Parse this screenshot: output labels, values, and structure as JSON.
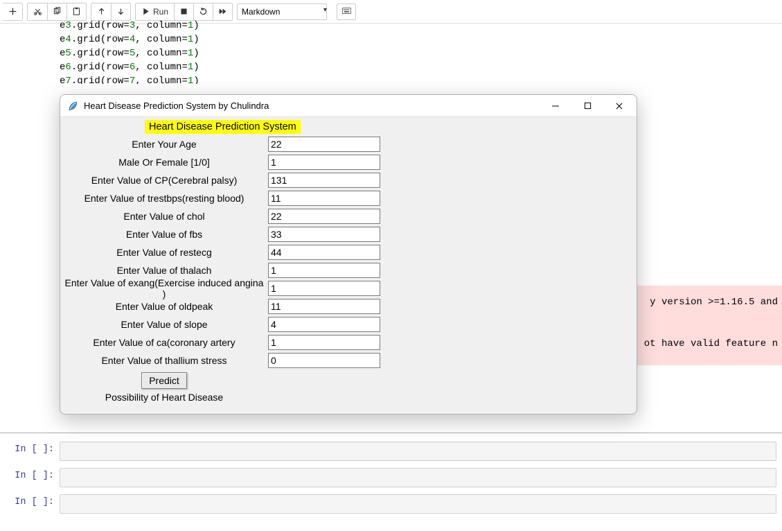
{
  "toolbar": {
    "save_icon": "save",
    "cut_icon": "cut",
    "copy_icon": "copy",
    "paste_icon": "paste",
    "up_icon": "up",
    "down_icon": "down",
    "run_label": "Run",
    "stop_icon": "stop",
    "restart_icon": "restart",
    "ff_icon": "fast-forward",
    "cell_type": "Markdown",
    "cmd_palette_icon": "keyboard"
  },
  "code_fragment_lines": [
    "e3.grid(row=3, column=1)",
    "e4.grid(row=4, column=1)",
    "e5.grid(row=5, column=1)",
    "e6.grid(row=6, column=1)",
    "e7.grid(row=7, column=1)"
  ],
  "warning": {
    "line1": "y version >=1.16.5 and",
    "line2": "ot have valid feature n"
  },
  "empty_cells": [
    "In [ ]:",
    "In [ ]:",
    "In [ ]:"
  ],
  "tk": {
    "window_title": "Heart Disease Prediction System by Chulindra",
    "heading": "Heart Disease Prediction System",
    "fields": [
      {
        "label": "Enter Your Age",
        "value": "22"
      },
      {
        "label": "Male Or Female [1/0]",
        "value": "1"
      },
      {
        "label": "Enter Value of CP(Cerebral palsy)",
        "value": "131"
      },
      {
        "label": "Enter Value of trestbps(resting blood)",
        "value": "11"
      },
      {
        "label": "Enter Value of chol",
        "value": "22"
      },
      {
        "label": "Enter Value of fbs",
        "value": "33"
      },
      {
        "label": "Enter Value of restecg",
        "value": "44"
      },
      {
        "label": "Enter Value of thalach",
        "value": "1"
      },
      {
        "label": "Enter Value of exang(Exercise induced angina )",
        "value": "1"
      },
      {
        "label": "Enter Value of oldpeak",
        "value": "11"
      },
      {
        "label": "Enter Value of slope",
        "value": "4"
      },
      {
        "label": "Enter Value of ca(coronary artery",
        "value": "1"
      },
      {
        "label": "Enter Value of thallium stress",
        "value": "0"
      }
    ],
    "predict_label": "Predict",
    "result_label": "Possibility of Heart Disease"
  }
}
